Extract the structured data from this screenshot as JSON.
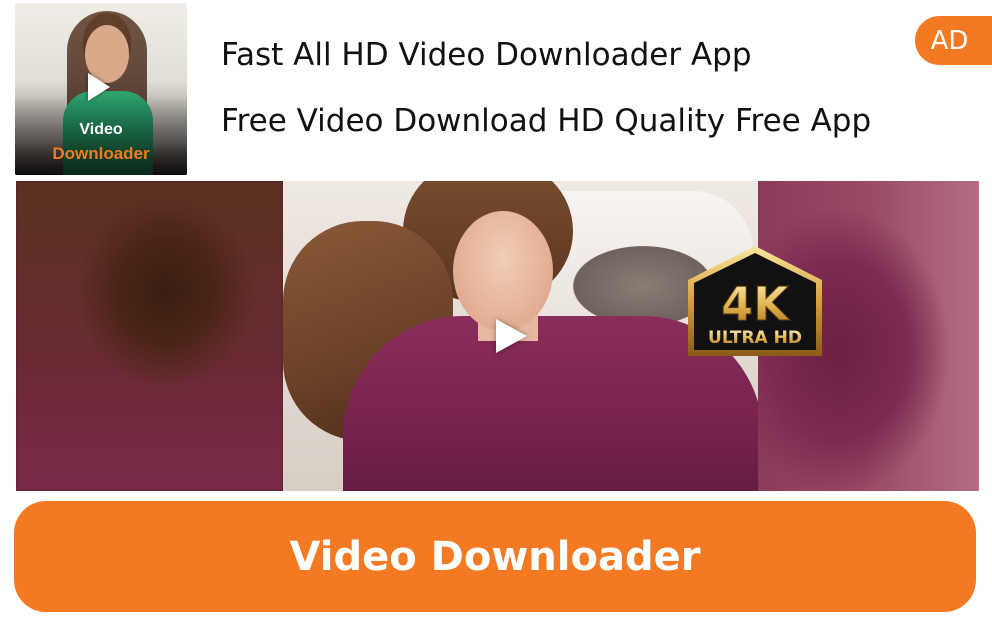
{
  "app_icon": {
    "label_line1": "Video",
    "label_line2": "Downloader",
    "icon": "play-icon",
    "label2_color": "#f37a22"
  },
  "headline": {
    "title": "Fast All HD Video Downloader App",
    "subtitle": "Free Video Download HD Quality Free App"
  },
  "ad_badge": {
    "label": "AD",
    "color": "#f37a22"
  },
  "media": {
    "play_icon": "play-icon",
    "badge": {
      "main": "4K",
      "sub": "ULTRA HD"
    }
  },
  "cta": {
    "label": "Video Downloader",
    "color": "#f37a22"
  }
}
